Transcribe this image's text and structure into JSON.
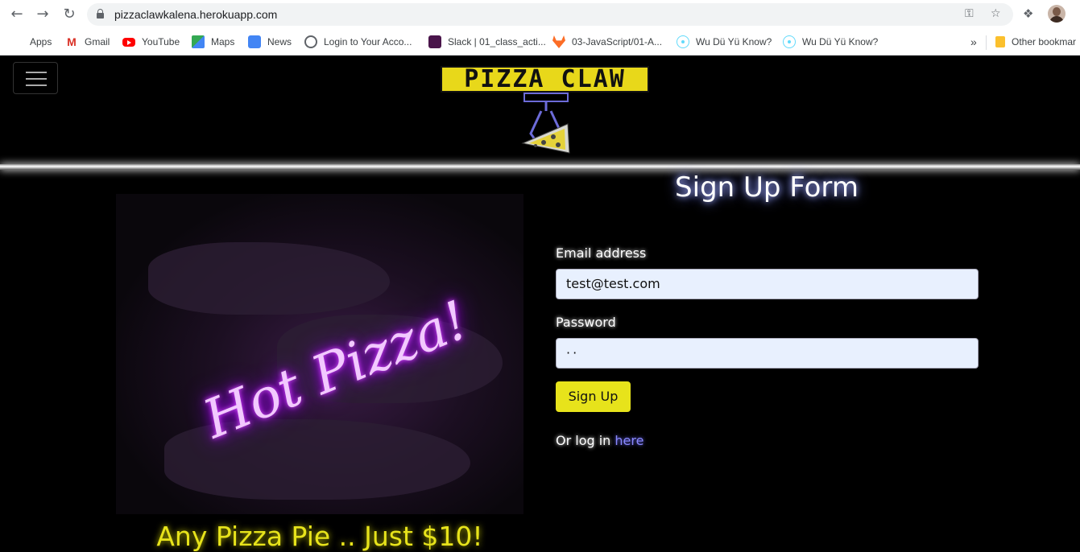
{
  "browser": {
    "url": "pizzaclawkalena.herokuapp.com",
    "bookmarks": [
      {
        "label": "Apps",
        "icon": "apps-grid-icon"
      },
      {
        "label": "Gmail",
        "icon": "gmail-icon"
      },
      {
        "label": "YouTube",
        "icon": "youtube-icon"
      },
      {
        "label": "Maps",
        "icon": "maps-icon"
      },
      {
        "label": "News",
        "icon": "news-icon"
      },
      {
        "label": "Login to Your Acco...",
        "icon": "globe-icon"
      },
      {
        "label": "Slack | 01_class_acti...",
        "icon": "slack-icon"
      },
      {
        "label": "03-JavaScript/01-A...",
        "icon": "gitlab-icon"
      },
      {
        "label": "Wu Dü Yü Know?",
        "icon": "react-icon"
      },
      {
        "label": "Wu Dü Yü Know?",
        "icon": "react-icon"
      }
    ],
    "overflow": "»",
    "other_bookmarks": "Other bookmar"
  },
  "header": {
    "logo_text": "PIZZA CLAW"
  },
  "hero": {
    "neon_sign_text": "Hot Pizza!",
    "promo": "Any Pizza Pie .. Just $10!"
  },
  "form": {
    "title": "Sign Up Form",
    "email_label": "Email address",
    "email_value": "test@test.com",
    "password_label": "Password",
    "password_value": "··",
    "submit_label": "Sign Up",
    "login_prefix": "Or log in ",
    "login_link": "here"
  },
  "colors": {
    "accent_yellow": "#e7e31b",
    "link_purple": "#8a89ff",
    "neon_purple": "#b300ff"
  }
}
